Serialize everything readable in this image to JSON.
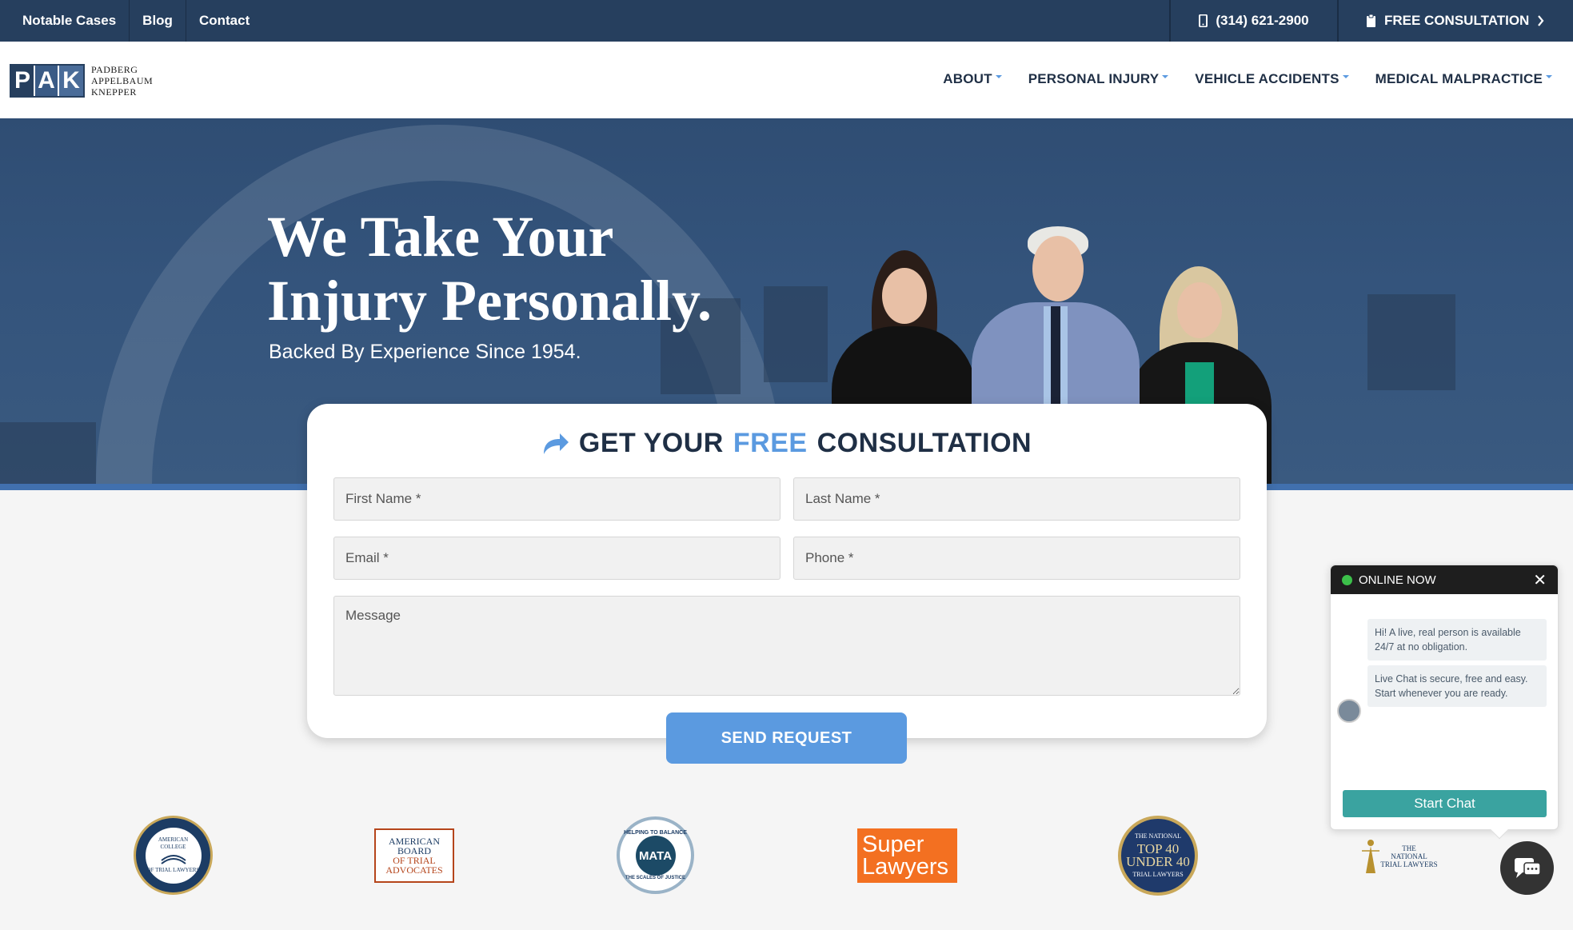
{
  "topbar": {
    "links": [
      "Notable Cases",
      "Blog",
      "Contact"
    ],
    "phone": "(314) 621-2900",
    "consult": "FREE CONSULTATION"
  },
  "logo": {
    "letters": [
      "P",
      "A",
      "K"
    ],
    "names": [
      "PADBERG",
      "APPELBAUM",
      "KNEPPER"
    ]
  },
  "nav": [
    "ABOUT",
    "PERSONAL INJURY",
    "VEHICLE ACCIDENTS",
    "MEDICAL MALPRACTICE"
  ],
  "hero": {
    "title_line1": "We Take Your",
    "title_line2": "Injury Personally.",
    "subtitle": "Backed By Experience Since 1954."
  },
  "form": {
    "title_a": "GET YOUR",
    "title_free": "FREE",
    "title_b": "CONSULTATION",
    "first_name": "First Name *",
    "last_name": "Last Name *",
    "email": "Email *",
    "phone": "Phone *",
    "message": "Message",
    "send": "SEND REQUEST"
  },
  "badges": {
    "acotl": [
      "AMERICAN COLLEGE",
      "OF TRIAL LAWYERS"
    ],
    "abota": [
      "AMERICAN",
      "BOARD",
      "OF TRIAL",
      "ADVOCATES"
    ],
    "mata": [
      "HELPING TO BALANCE",
      "MATA",
      "THE SCALES OF JUSTICE"
    ],
    "superlawyers": [
      "Super",
      "Lawyers"
    ],
    "ntl": [
      "THE NATIONAL",
      "TOP 40",
      "UNDER 40",
      "TRIAL LAWYERS"
    ],
    "ntl2": [
      "THE",
      "NATIONAL",
      "TRIAL LAWYERS"
    ]
  },
  "chat": {
    "status": "ONLINE NOW",
    "msg1": "Hi! A live, real person is available 24/7 at no obligation.",
    "msg2": "Live Chat is secure, free and easy. Start whenever you are ready.",
    "start": "Start Chat"
  },
  "colors": {
    "navy": "#263f5e",
    "accent": "#5b9ae0",
    "chat_teal": "#3aa3a0"
  }
}
